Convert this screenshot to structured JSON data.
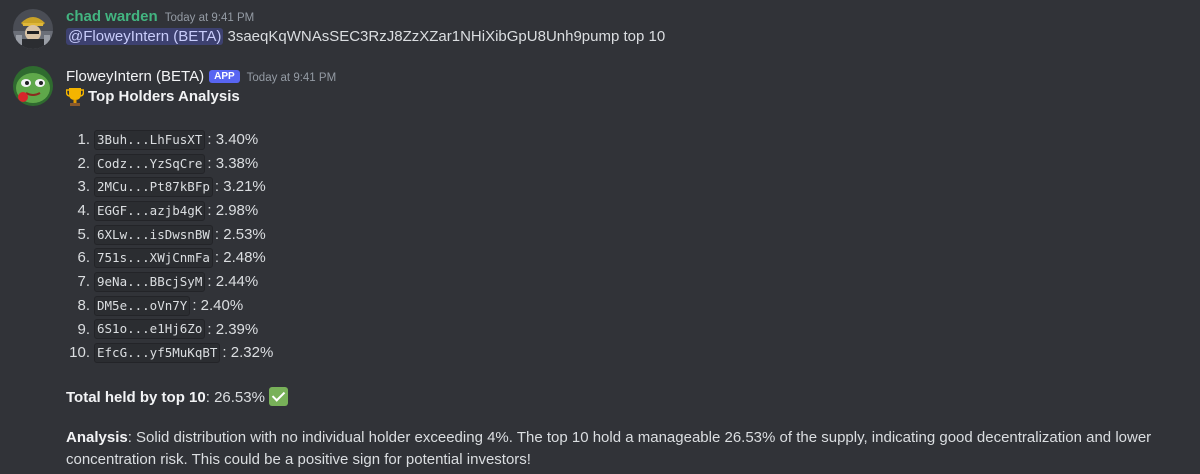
{
  "messages": [
    {
      "username": "chad warden",
      "timestamp": "Today at 9:41 PM",
      "mention": "@FloweyIntern (BETA)",
      "text": " 3saeqKqWNAsSEC3RzJ8ZzXZar1NHiXibGpU8Unh9pump top 10"
    },
    {
      "username": "FloweyIntern (BETA)",
      "badge": "APP",
      "timestamp": "Today at 9:41 PM",
      "title": "Top Holders Analysis",
      "holders": [
        {
          "num": "1.",
          "address": "3Buh...LhFusXT",
          "pct": ": 3.40%"
        },
        {
          "num": "2.",
          "address": "Codz...YzSqCre",
          "pct": ": 3.38%"
        },
        {
          "num": "3.",
          "address": "2MCu...Pt87kBFp",
          "pct": ": 3.21%"
        },
        {
          "num": "4.",
          "address": "EGGF...azjb4gK",
          "pct": ": 2.98%"
        },
        {
          "num": "5.",
          "address": "6XLw...isDwsnBW",
          "pct": ": 2.53%"
        },
        {
          "num": "6.",
          "address": "751s...XWjCnmFa",
          "pct": ": 2.48%"
        },
        {
          "num": "7.",
          "address": "9eNa...BBcjSyM",
          "pct": ": 2.44%"
        },
        {
          "num": "8.",
          "address": "DM5e...oVn7Y",
          "pct": ": 2.40%"
        },
        {
          "num": "9.",
          "address": "6S1o...e1Hj6Zo",
          "pct": ": 2.39%"
        },
        {
          "num": "10.",
          "address": "EfcG...yf5MuKqBT",
          "pct": ": 2.32%"
        }
      ],
      "total_label": "Total held by top 10",
      "total_value": ": 26.53%",
      "analysis_label": "Analysis",
      "analysis_text": ": Solid distribution with no individual holder exceeding 4%. The top 10 hold a manageable 26.53% of the supply, indicating good decentralization and lower concentration risk. This could be a positive sign for potential investors!"
    }
  ],
  "icons": {
    "trophy": "trophy-icon",
    "check": "check-mark-icon"
  },
  "colors": {
    "background": "#313338",
    "chad_name": "#43b581",
    "app_badge": "#5865f2",
    "mention_bg": "#5865f24d",
    "check_bg": "#78b159"
  }
}
